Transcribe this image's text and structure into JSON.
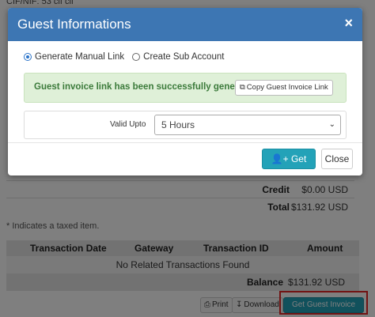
{
  "page": {
    "top_text": "CIF/NIF: 53 cif cif",
    "totals": [
      {
        "label": "Credit",
        "value": "$0.00 USD"
      },
      {
        "label": "Total",
        "value": "$131.92 USD"
      }
    ],
    "tax_note": "* Indicates a taxed item.",
    "transactions": {
      "headers": [
        "Transaction Date",
        "Gateway",
        "Transaction ID",
        "Amount"
      ],
      "empty_text": "No Related Transactions Found",
      "balance_label": "Balance",
      "balance_value": "$131.92 USD"
    },
    "buttons": {
      "print": "Print",
      "download": "Download",
      "guest_invoice": "Get Guest Invoice Link"
    }
  },
  "modal": {
    "title": "Guest Informations",
    "close_symbol": "×",
    "radio_options": [
      {
        "label": "Generate Manual Link",
        "checked": true
      },
      {
        "label": "Create Sub Account",
        "checked": false
      }
    ],
    "alert_text": "Guest invoice link has been successfully generated",
    "copy_button": "Copy Guest Invoice Link",
    "valid_upto_label": "Valid Upto",
    "valid_upto_value": "5 Hours",
    "get_link_button": "Get Link",
    "close_button": "Close"
  },
  "colors": {
    "modal_header": "#3d76b3",
    "teal_button": "#23a2b8",
    "alert_bg": "#dff0d8",
    "alert_text": "#3b7a3a",
    "highlight": "#e32626"
  }
}
